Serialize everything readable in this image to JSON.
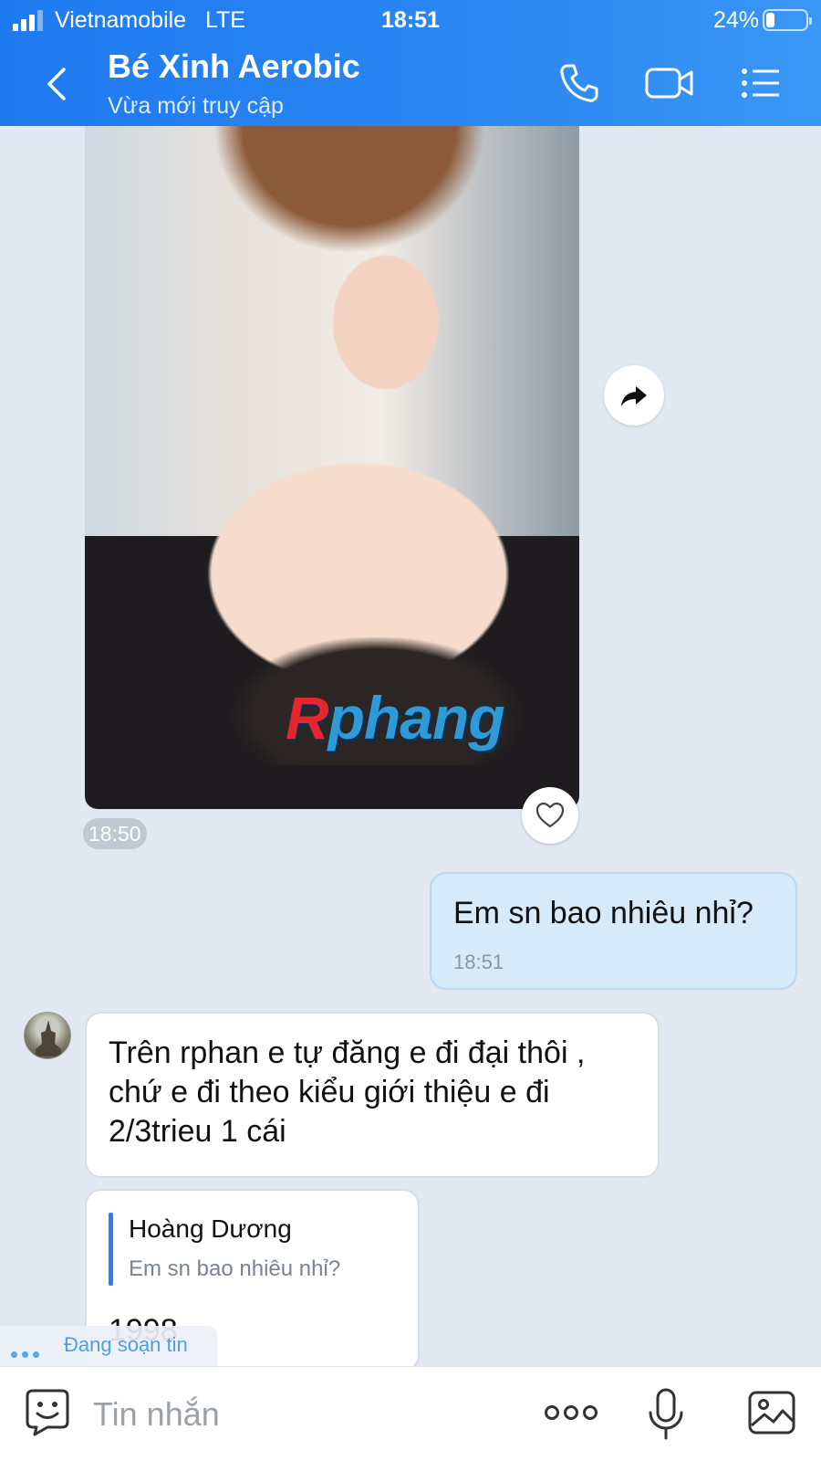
{
  "status_bar": {
    "carrier": "Vietnamobile",
    "network": "LTE",
    "time": "18:51",
    "battery": "24%",
    "battery_level": 0.24
  },
  "header": {
    "contact_name": "Bé Xinh Aerobic",
    "presence": "Vừa mới truy cập",
    "icons": [
      "back-icon",
      "phone-icon",
      "video-call-icon",
      "menu-icon"
    ]
  },
  "messages": {
    "photo": {
      "watermark_first": "R",
      "watermark_rest": "phang",
      "time": "18:50"
    },
    "outgoing": {
      "text": "Em sn bao nhiêu nhỉ?",
      "time": "18:51"
    },
    "incoming": {
      "text": "Trên rphan e tự đăng e đi đại thôi , chứ e đi theo kiểu giới thiệu e đi 2/3trieu 1 cái"
    },
    "quoted_reply": {
      "quote_author": "Hoàng Dương",
      "quote_text": "Em sn bao nhiêu nhỉ?",
      "reply_text": "1998"
    }
  },
  "typing_indicator": {
    "label": "Đang soạn tin"
  },
  "composer": {
    "placeholder": "Tin nhắn",
    "icons": [
      "emoji-icon",
      "more-icon",
      "microphone-icon",
      "gallery-icon"
    ]
  },
  "colors": {
    "header": "#2a86f2",
    "chat_background": "#e2e8f1",
    "outgoing_bubble": "#d6eafa",
    "accent": "#2f7ff0"
  }
}
